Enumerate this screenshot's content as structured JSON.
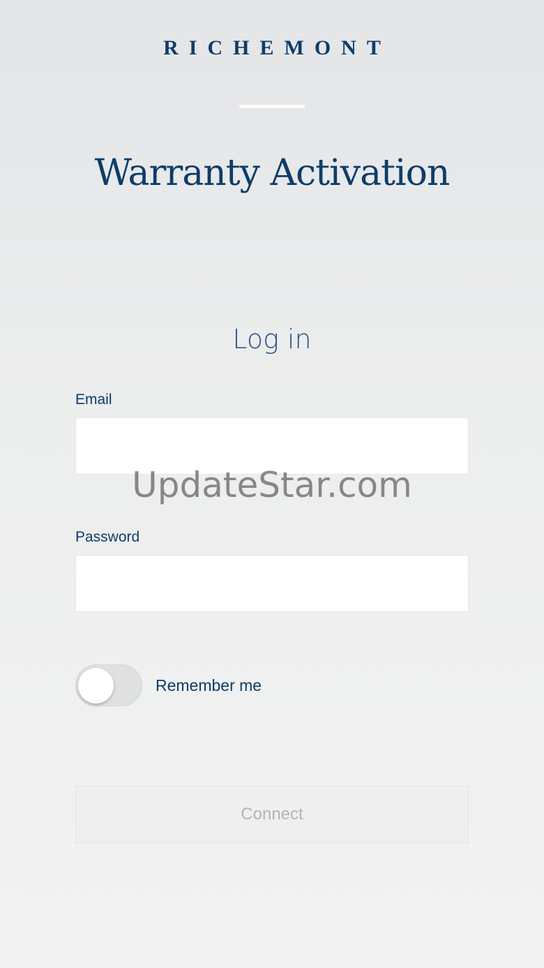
{
  "header": {
    "brand": "RICHEMONT",
    "title": "Warranty Activation"
  },
  "login": {
    "heading": "Log in",
    "email_label": "Email",
    "email_value": "",
    "password_label": "Password",
    "password_value": "",
    "remember_label": "Remember me",
    "remember_on": false,
    "connect_label": "Connect"
  },
  "watermark": "UpdateStar.com",
  "colors": {
    "brand_blue": "#0f3c68",
    "heading_blue": "#1e5386",
    "disabled_text": "#b4b4b4"
  }
}
